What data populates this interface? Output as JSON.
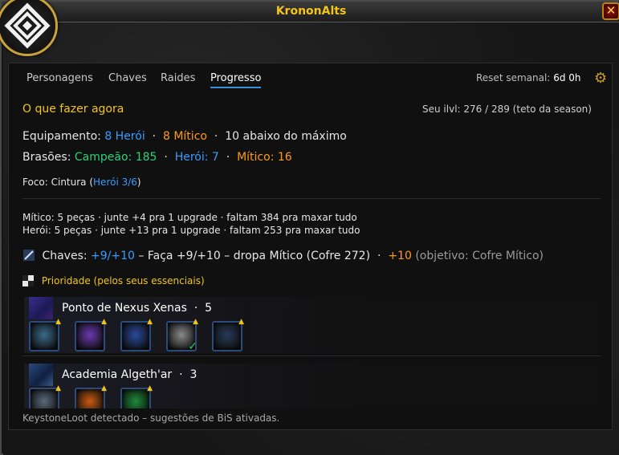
{
  "window": {
    "title": "KrononAlts",
    "close_label": "✕"
  },
  "tabs": [
    "Personagens",
    "Chaves",
    "Raides",
    "Progresso"
  ],
  "active_tab_index": 3,
  "reset": {
    "label": "Reset semanal:",
    "value": "6d 0h"
  },
  "header": {
    "title": "O que fazer agora",
    "ilvl": "Seu ilvl: 276 / 289 (teto da season)"
  },
  "equipment": {
    "label": "Equipamento:",
    "hero": "8 Herói",
    "dot1": "·",
    "myth": "8 Mítico",
    "dot2": "·",
    "below": "10 abaixo do máximo"
  },
  "crests": {
    "label": "Brasões:",
    "champion": "Campeão: 185",
    "dot1": "·",
    "hero": "Herói: 7",
    "dot2": "·",
    "myth": "Mítico: 16"
  },
  "focus": {
    "label": "Foco: Cintura (",
    "value": "Herói 3/6",
    "close": ")"
  },
  "summary": {
    "mythic": "Mítico: 5 peças · junte +4 pra 1 upgrade · faltam 384 pra maxar tudo",
    "hero": "Herói: 5 peças · junte +13 pra 1 upgrade · faltam 253 pra maxar tudo"
  },
  "keys": {
    "label": "Chaves:",
    "current": "+9/+10",
    "dash1": "–",
    "text": "Faça +9/+10 – dropa Mítico (Cofre 272)",
    "dot": "·",
    "target": "+10",
    "target_note": "(objetivo: Cofre Mítico)"
  },
  "priority": {
    "label": "Prioridade (pelos seus essenciais)"
  },
  "dungeons": [
    {
      "name": "Ponto de Nexus Xenas",
      "dot": "·",
      "count": "5",
      "slots": [
        {
          "icon": "shoulder-icon",
          "color": "#3a6a8a",
          "upgrade": true,
          "done": false
        },
        {
          "icon": "orb-icon",
          "color": "#6a3ab0",
          "upgrade": true,
          "done": false
        },
        {
          "icon": "chest-icon",
          "color": "#2a4a9a",
          "upgrade": true,
          "done": false
        },
        {
          "icon": "belt-icon",
          "color": "#8a8a8a",
          "upgrade": true,
          "done": true
        },
        {
          "icon": "leg-icon",
          "color": "#2a3a5a",
          "upgrade": true,
          "done": false
        }
      ]
    },
    {
      "name": "Academia Algeth'ar",
      "dot": "·",
      "count": "3",
      "slots": [
        {
          "icon": "shoulder-icon",
          "color": "#5a6a7a",
          "upgrade": true,
          "done": false
        },
        {
          "icon": "fire-icon",
          "color": "#c85a10",
          "upgrade": true,
          "done": false
        },
        {
          "icon": "green-icon",
          "color": "#1e8a3a",
          "upgrade": true,
          "done": false
        }
      ]
    }
  ],
  "footer": "KeystoneLoot detectado – sugestões de BiS ativadas.",
  "colors": {
    "accent": "#f3c518",
    "hero": "#3a9cff",
    "myth": "#ff9a1a",
    "champion": "#2fd07a"
  }
}
